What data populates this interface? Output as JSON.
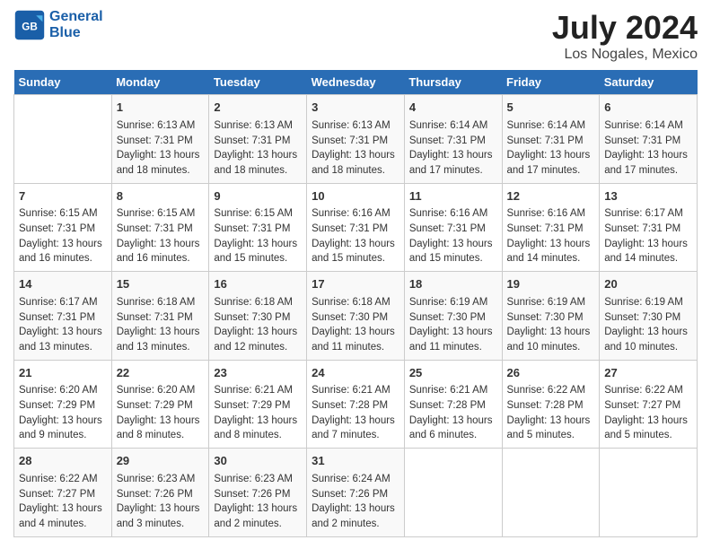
{
  "logo": {
    "line1": "General",
    "line2": "Blue"
  },
  "title": "July 2024",
  "subtitle": "Los Nogales, Mexico",
  "days_of_week": [
    "Sunday",
    "Monday",
    "Tuesday",
    "Wednesday",
    "Thursday",
    "Friday",
    "Saturday"
  ],
  "weeks": [
    [
      {
        "day": "",
        "info": ""
      },
      {
        "day": "1",
        "info": "Sunrise: 6:13 AM\nSunset: 7:31 PM\nDaylight: 13 hours and 18 minutes."
      },
      {
        "day": "2",
        "info": "Sunrise: 6:13 AM\nSunset: 7:31 PM\nDaylight: 13 hours and 18 minutes."
      },
      {
        "day": "3",
        "info": "Sunrise: 6:13 AM\nSunset: 7:31 PM\nDaylight: 13 hours and 18 minutes."
      },
      {
        "day": "4",
        "info": "Sunrise: 6:14 AM\nSunset: 7:31 PM\nDaylight: 13 hours and 17 minutes."
      },
      {
        "day": "5",
        "info": "Sunrise: 6:14 AM\nSunset: 7:31 PM\nDaylight: 13 hours and 17 minutes."
      },
      {
        "day": "6",
        "info": "Sunrise: 6:14 AM\nSunset: 7:31 PM\nDaylight: 13 hours and 17 minutes."
      }
    ],
    [
      {
        "day": "7",
        "info": "Sunrise: 6:15 AM\nSunset: 7:31 PM\nDaylight: 13 hours and 16 minutes."
      },
      {
        "day": "8",
        "info": "Sunrise: 6:15 AM\nSunset: 7:31 PM\nDaylight: 13 hours and 16 minutes."
      },
      {
        "day": "9",
        "info": "Sunrise: 6:15 AM\nSunset: 7:31 PM\nDaylight: 13 hours and 15 minutes."
      },
      {
        "day": "10",
        "info": "Sunrise: 6:16 AM\nSunset: 7:31 PM\nDaylight: 13 hours and 15 minutes."
      },
      {
        "day": "11",
        "info": "Sunrise: 6:16 AM\nSunset: 7:31 PM\nDaylight: 13 hours and 15 minutes."
      },
      {
        "day": "12",
        "info": "Sunrise: 6:16 AM\nSunset: 7:31 PM\nDaylight: 13 hours and 14 minutes."
      },
      {
        "day": "13",
        "info": "Sunrise: 6:17 AM\nSunset: 7:31 PM\nDaylight: 13 hours and 14 minutes."
      }
    ],
    [
      {
        "day": "14",
        "info": "Sunrise: 6:17 AM\nSunset: 7:31 PM\nDaylight: 13 hours and 13 minutes."
      },
      {
        "day": "15",
        "info": "Sunrise: 6:18 AM\nSunset: 7:31 PM\nDaylight: 13 hours and 13 minutes."
      },
      {
        "day": "16",
        "info": "Sunrise: 6:18 AM\nSunset: 7:30 PM\nDaylight: 13 hours and 12 minutes."
      },
      {
        "day": "17",
        "info": "Sunrise: 6:18 AM\nSunset: 7:30 PM\nDaylight: 13 hours and 11 minutes."
      },
      {
        "day": "18",
        "info": "Sunrise: 6:19 AM\nSunset: 7:30 PM\nDaylight: 13 hours and 11 minutes."
      },
      {
        "day": "19",
        "info": "Sunrise: 6:19 AM\nSunset: 7:30 PM\nDaylight: 13 hours and 10 minutes."
      },
      {
        "day": "20",
        "info": "Sunrise: 6:19 AM\nSunset: 7:30 PM\nDaylight: 13 hours and 10 minutes."
      }
    ],
    [
      {
        "day": "21",
        "info": "Sunrise: 6:20 AM\nSunset: 7:29 PM\nDaylight: 13 hours and 9 minutes."
      },
      {
        "day": "22",
        "info": "Sunrise: 6:20 AM\nSunset: 7:29 PM\nDaylight: 13 hours and 8 minutes."
      },
      {
        "day": "23",
        "info": "Sunrise: 6:21 AM\nSunset: 7:29 PM\nDaylight: 13 hours and 8 minutes."
      },
      {
        "day": "24",
        "info": "Sunrise: 6:21 AM\nSunset: 7:28 PM\nDaylight: 13 hours and 7 minutes."
      },
      {
        "day": "25",
        "info": "Sunrise: 6:21 AM\nSunset: 7:28 PM\nDaylight: 13 hours and 6 minutes."
      },
      {
        "day": "26",
        "info": "Sunrise: 6:22 AM\nSunset: 7:28 PM\nDaylight: 13 hours and 5 minutes."
      },
      {
        "day": "27",
        "info": "Sunrise: 6:22 AM\nSunset: 7:27 PM\nDaylight: 13 hours and 5 minutes."
      }
    ],
    [
      {
        "day": "28",
        "info": "Sunrise: 6:22 AM\nSunset: 7:27 PM\nDaylight: 13 hours and 4 minutes."
      },
      {
        "day": "29",
        "info": "Sunrise: 6:23 AM\nSunset: 7:26 PM\nDaylight: 13 hours and 3 minutes."
      },
      {
        "day": "30",
        "info": "Sunrise: 6:23 AM\nSunset: 7:26 PM\nDaylight: 13 hours and 2 minutes."
      },
      {
        "day": "31",
        "info": "Sunrise: 6:24 AM\nSunset: 7:26 PM\nDaylight: 13 hours and 2 minutes."
      },
      {
        "day": "",
        "info": ""
      },
      {
        "day": "",
        "info": ""
      },
      {
        "day": "",
        "info": ""
      }
    ]
  ]
}
